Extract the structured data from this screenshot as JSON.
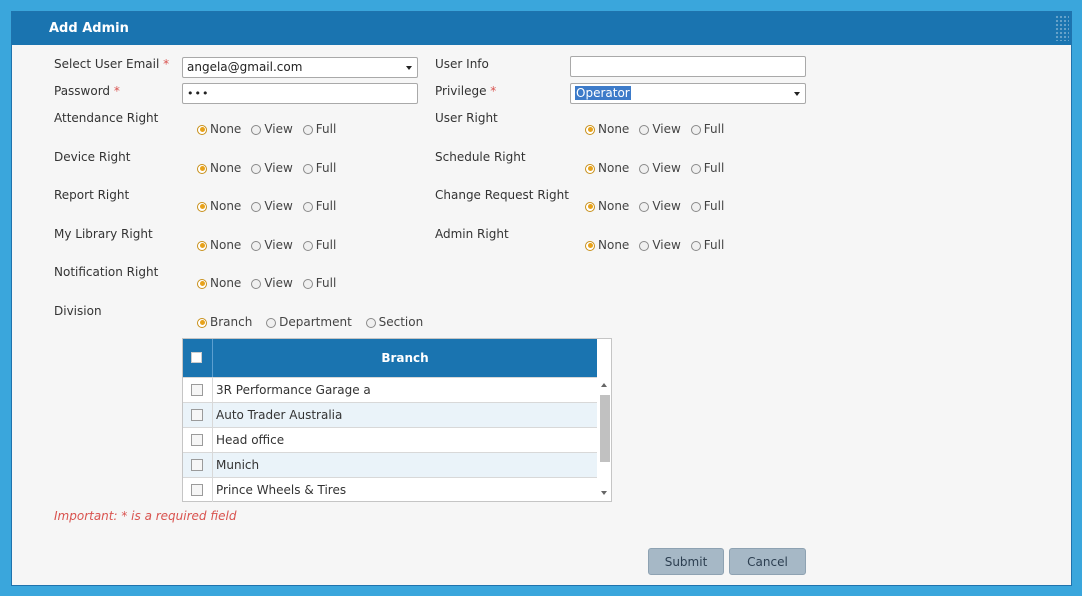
{
  "dialog": {
    "title": "Add Admin"
  },
  "form": {
    "email": {
      "label": "Select User Email",
      "required": "*",
      "value": "angela@gmail.com"
    },
    "password": {
      "label": "Password",
      "required": "*",
      "value": "•••"
    },
    "user_info": {
      "label": "User Info",
      "value": ""
    },
    "privilege": {
      "label": "Privilege",
      "required": "*",
      "value": "Operator"
    }
  },
  "rights": [
    {
      "label": "Attendance Right",
      "selected": "None"
    },
    {
      "label": "Device Right",
      "selected": "None"
    },
    {
      "label": "Report Right",
      "selected": "None"
    },
    {
      "label": "My Library Right",
      "selected": "None"
    },
    {
      "label": "Notification Right",
      "selected": "None"
    },
    {
      "label": "User Right",
      "selected": "None"
    },
    {
      "label": "Schedule Right",
      "selected": "None"
    },
    {
      "label": "Change Request Right",
      "selected": "None"
    },
    {
      "label": "Admin Right",
      "selected": "None"
    }
  ],
  "right_options": [
    "None",
    "View",
    "Full"
  ],
  "division": {
    "label": "Division",
    "options": [
      "Branch",
      "Department",
      "Section"
    ],
    "selected": "Branch"
  },
  "branch_table": {
    "header": "Branch",
    "rows": [
      "3R Performance Garage a",
      "Auto Trader Australia",
      "Head office",
      "Munich",
      "Prince Wheels & Tires"
    ]
  },
  "important_note": "Important: * is a required field",
  "buttons": {
    "submit": "Submit",
    "cancel": "Cancel"
  },
  "colors": {
    "accent": "#1a74b0",
    "required": "#d9534f",
    "radio_selected": "#e8a21a",
    "button": "#a6b8c6"
  }
}
